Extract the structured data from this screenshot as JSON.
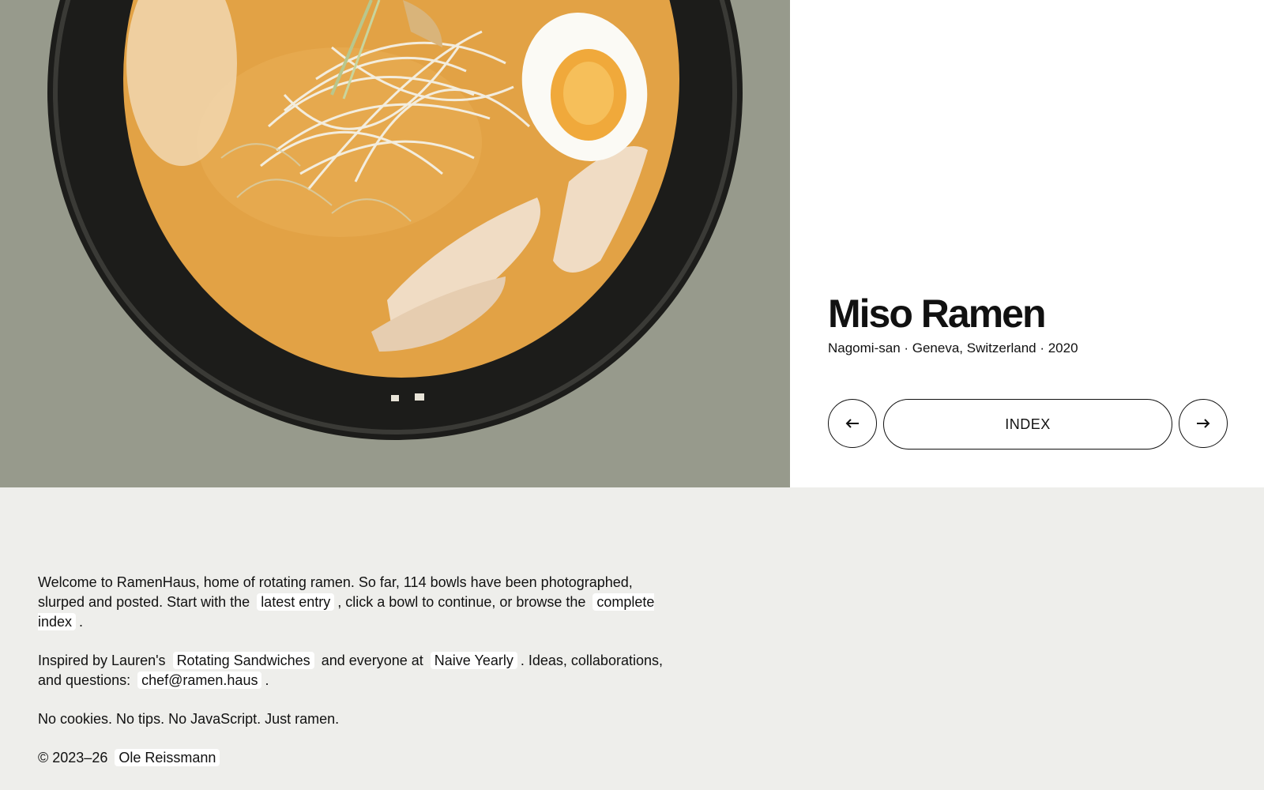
{
  "entry": {
    "title": "Miso Ramen",
    "meta": "Nagomi-san · Geneva, Switzerland · 2020",
    "photo_icon": "ramen-bowl-photo"
  },
  "nav": {
    "prev_icon": "arrow-left-icon",
    "index_label": "INDEX",
    "next_icon": "arrow-right-icon"
  },
  "footer": {
    "p1_a": "Welcome to RamenHaus, home of rotating ramen. So far, 114 bowls have been photographed, slurped and posted. Start with the",
    "latest_link": "latest entry",
    "p1_b": ", click a bowl to continue, or browse the",
    "index_link": "complete index",
    "p1_c": ".",
    "p2_a": "Inspired by Lauren's",
    "sandwiches_link": "Rotating Sandwiches",
    "p2_b": "and everyone at",
    "naive_link": "Naive Yearly",
    "p2_c": ". Ideas, collaborations, and questions:",
    "email_link": "chef@ramen.haus",
    "p2_d": ".",
    "p3": "No cookies. No tips. No JavaScript. Just ramen.",
    "copyright": "© 2023–26",
    "author_link": "Ole Reissmann"
  },
  "colors": {
    "photo_bg": "#979a8c",
    "footer_bg": "#eeeeeb",
    "broth": "#e2a245",
    "bowl": "#1c1c1a"
  }
}
